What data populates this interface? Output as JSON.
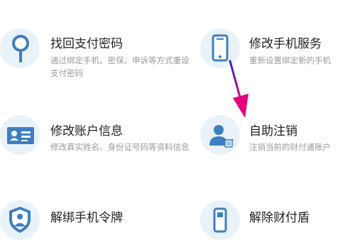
{
  "items": [
    {
      "title": "找回支付密码",
      "desc": [
        "通过绑定手机、密保、申诉等方式重设",
        "支付密码"
      ],
      "icon": "magnifier-icon"
    },
    {
      "title": "修改手机服务",
      "desc": [
        "重新设置绑定新的手机"
      ],
      "icon": "phone-icon"
    },
    {
      "title": "修改账户信息",
      "desc": [
        "修改真实姓名、身份证号码等资料信息"
      ],
      "icon": "id-card-icon"
    },
    {
      "title": "自助注销",
      "desc": [
        "注销当前的财付通账户"
      ],
      "icon": "user-delete-icon"
    },
    {
      "title": "解绑手机令牌",
      "desc": [],
      "icon": "shield-user-icon"
    },
    {
      "title": "解除财付盾",
      "desc": [],
      "icon": "usb-key-icon"
    }
  ],
  "colors": {
    "icon_bg": "#e9f2f8",
    "icon_blue": "#3d7fc1",
    "annotation_arrow": "#e4007f"
  }
}
